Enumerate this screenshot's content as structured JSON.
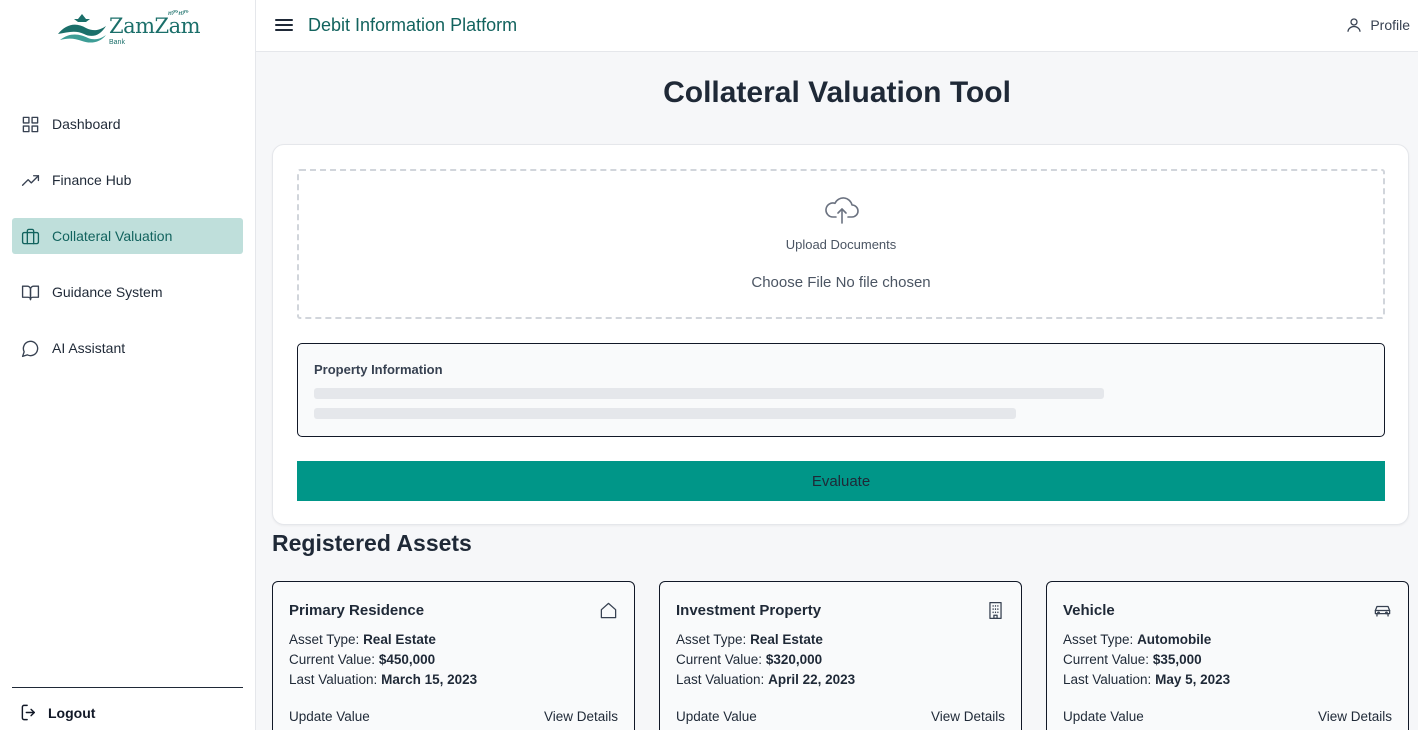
{
  "brand": {
    "name": "ZamZam",
    "sub": "Bank",
    "script": "ዘምዘም"
  },
  "sidebar": {
    "items": [
      {
        "label": "Dashboard",
        "icon": "grid-icon",
        "active": false
      },
      {
        "label": "Finance Hub",
        "icon": "trending-up-icon",
        "active": false
      },
      {
        "label": "Collateral Valuation",
        "icon": "briefcase-icon",
        "active": true
      },
      {
        "label": "Guidance System",
        "icon": "book-icon",
        "active": false
      },
      {
        "label": "AI Assistant",
        "icon": "chat-bubble-icon",
        "active": false
      }
    ],
    "logout_label": "Logout"
  },
  "header": {
    "title": "Debit Information Platform",
    "profile_label": "Profile"
  },
  "main": {
    "title": "Collateral Valuation Tool",
    "upload": {
      "label": "Upload Documents",
      "file_button": "Choose File",
      "file_status": "No file chosen"
    },
    "property_label": "Property Information",
    "evaluate_label": "Evaluate",
    "assets_heading": "Registered Assets"
  },
  "asset_labels": {
    "type": "Asset Type:",
    "value": "Current Value:",
    "valuation": "Last Valuation:",
    "update": "Update Value",
    "details": "View Details"
  },
  "assets": [
    {
      "title": "Primary Residence",
      "icon": "house-icon",
      "type": "Real Estate",
      "value": "$450,000",
      "valuation": "March 15, 2023"
    },
    {
      "title": "Investment Property",
      "icon": "building-icon",
      "type": "Real Estate",
      "value": "$320,000",
      "valuation": "April 22, 2023"
    },
    {
      "title": "Vehicle",
      "icon": "car-icon",
      "type": "Automobile",
      "value": "$35,000",
      "valuation": "May 5, 2023"
    }
  ],
  "colors": {
    "brand": "#12635e",
    "accent": "#009688",
    "active_bg": "#bfdfdb"
  }
}
